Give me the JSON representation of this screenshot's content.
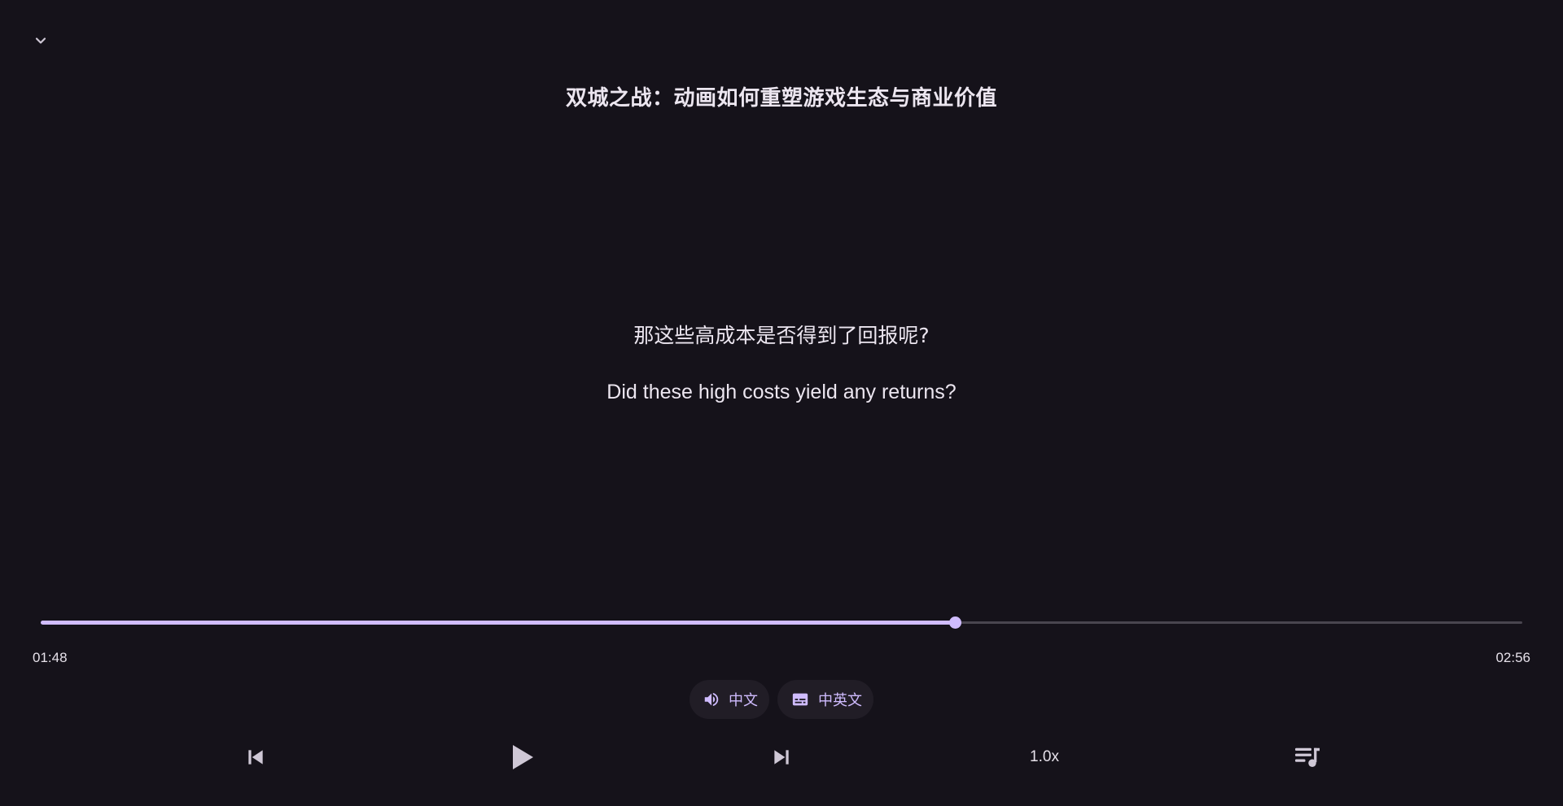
{
  "header": {
    "collapse_icon": "chevron-down-icon",
    "title": "双城之战：动画如何重塑游戏生态与商业价值"
  },
  "subtitles": {
    "chinese": "那这些高成本是否得到了回报呢?",
    "english": "Did these high costs yield any returns?"
  },
  "playback": {
    "current_time": "01:48",
    "total_time": "02:56",
    "progress_fraction": 0.6175
  },
  "chips": {
    "audio_language": {
      "icon": "volume-icon",
      "label": "中文"
    },
    "subtitle_mode": {
      "icon": "subtitles-icon",
      "label": "中英文"
    }
  },
  "controls": {
    "previous_icon": "skip-previous-icon",
    "play_icon": "play-icon",
    "next_icon": "skip-next-icon",
    "speed_label": "1.0x",
    "playlist_icon": "playlist-icon"
  },
  "colors": {
    "background": "#15121a",
    "accent": "#d0bcff",
    "text": "#e6e1ea",
    "chip_background": "#211d26"
  }
}
